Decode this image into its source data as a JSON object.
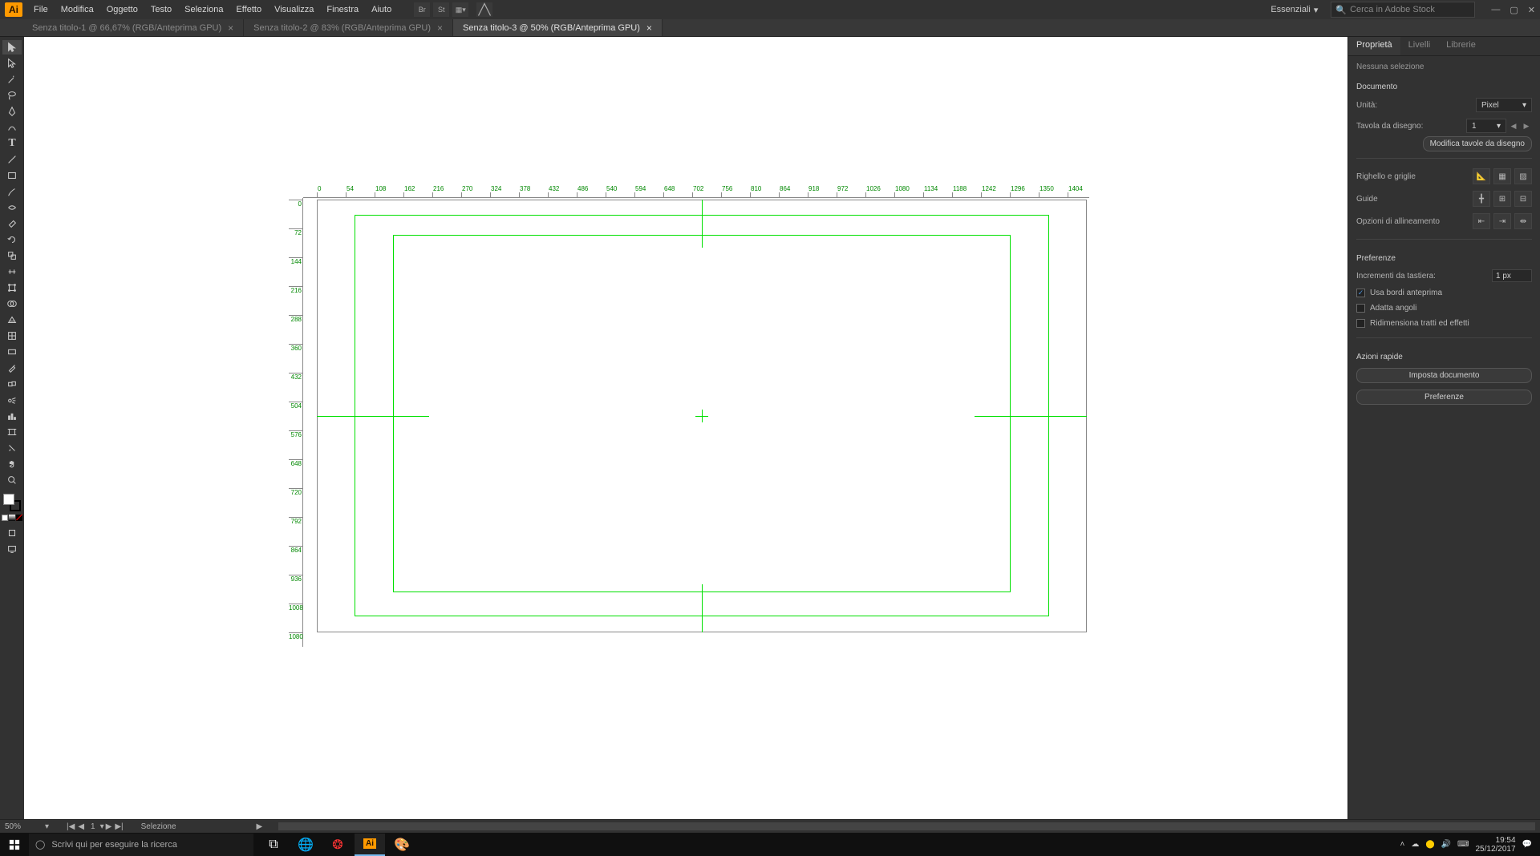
{
  "app": {
    "logo": "Ai"
  },
  "menu": [
    "File",
    "Modifica",
    "Oggetto",
    "Testo",
    "Seleziona",
    "Effetto",
    "Visualizza",
    "Finestra",
    "Aiuto"
  ],
  "workspace": {
    "label": "Essenziali"
  },
  "search": {
    "placeholder": "Cerca in Adobe Stock"
  },
  "tabs": [
    {
      "label": "Senza titolo-1 @ 66,67% (RGB/Anteprima GPU)",
      "active": false
    },
    {
      "label": "Senza titolo-2 @ 83% (RGB/Anteprima GPU)",
      "active": false
    },
    {
      "label": "Senza titolo-3 @ 50% (RGB/Anteprima GPU)",
      "active": true
    }
  ],
  "tools": [
    "selection",
    "direct-selection",
    "magic-wand",
    "lasso",
    "pen",
    "curvature",
    "type",
    "line",
    "rectangle",
    "brush",
    "shaper",
    "eraser",
    "rotate",
    "scale",
    "width",
    "free-transform",
    "shape-builder",
    "perspective",
    "mesh",
    "gradient",
    "eyedropper",
    "blend",
    "symbol-spray",
    "column-graph",
    "artboard",
    "slice",
    "hand",
    "zoom"
  ],
  "ruler_h": [
    "0",
    "54",
    "108",
    "162",
    "216",
    "270",
    "324",
    "378",
    "432",
    "486",
    "540",
    "594",
    "648",
    "702",
    "756",
    "810",
    "864",
    "918",
    "972",
    "1026",
    "1080",
    "1134",
    "1188",
    "1242",
    "1296",
    "1350",
    "1404"
  ],
  "ruler_v": [
    "0",
    "72",
    "144",
    "216",
    "288",
    "360",
    "432",
    "504",
    "576",
    "648",
    "720",
    "792",
    "864",
    "936",
    "1008",
    "1080"
  ],
  "panels": {
    "tabs": [
      "Proprietà",
      "Livelli",
      "Librerie"
    ],
    "no_selection": "Nessuna selezione",
    "document": "Documento",
    "units_label": "Unità:",
    "units_value": "Pixel",
    "artboard_label": "Tavola da disegno:",
    "artboard_value": "1",
    "edit_artboards": "Modifica tavole da disegno",
    "ruler_grid": "Righello e griglie",
    "guides": "Guide",
    "align_opts": "Opzioni di allineamento",
    "prefs": "Preferenze",
    "keyboard_inc": "Incrementi da tastiera:",
    "keyboard_inc_val": "1 px",
    "cb_preview": "Usa bordi anteprima",
    "cb_corners": "Adatta angoli",
    "cb_resize": "Ridimensiona tratti ed effetti",
    "quick_actions": "Azioni rapide",
    "btn_doc_setup": "Imposta documento",
    "btn_prefs": "Preferenze"
  },
  "status": {
    "zoom": "50%",
    "artboard_num": "1",
    "label": "Selezione"
  },
  "taskbar": {
    "search_placeholder": "Scrivi qui per eseguire la ricerca",
    "time": "19:54",
    "date": "25/12/2017"
  }
}
